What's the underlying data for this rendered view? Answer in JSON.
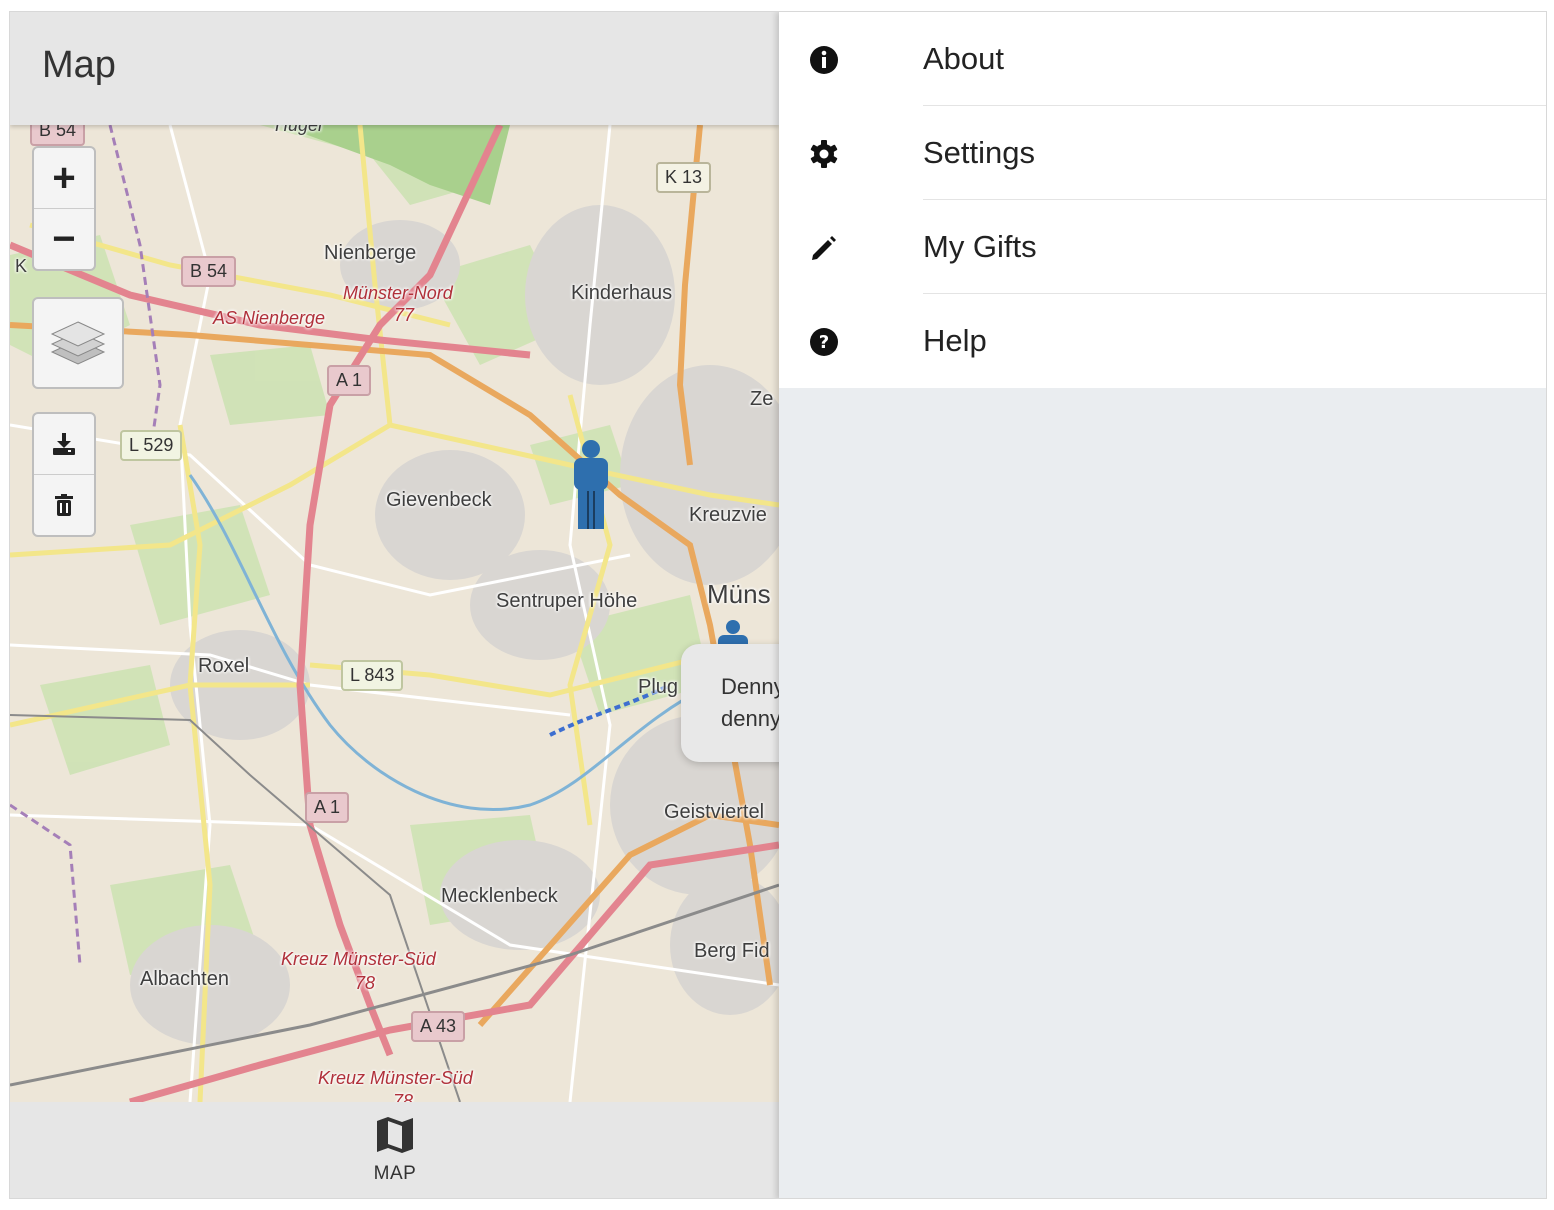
{
  "header": {
    "title": "Map"
  },
  "map": {
    "place_labels": [
      "Nienberge",
      "Kinderhaus",
      "Gievenbeck",
      "Kreuzvie",
      "Sentruper Höhe",
      "Müns",
      "Roxel",
      "Plug",
      "Geistviertel",
      "Mecklenbeck",
      "Berg Fid",
      "Albachten",
      "Ze",
      "Hügel",
      "K"
    ],
    "motorway_labels": [
      "Münster-Nord",
      "77",
      "AS Nienberge",
      "Kreuz Münster-Süd",
      "78",
      "Kreuz Münster-Süd",
      "78"
    ],
    "road_shields": [
      "B 54",
      "K 13",
      "B 54",
      "A 1",
      "L 529",
      "L 843",
      "A 1",
      "A 43"
    ],
    "controls": {
      "zoom_in": "+",
      "zoom_out": "−"
    }
  },
  "popup": {
    "line1": "Denny",
    "line2": "denny"
  },
  "tabbar": {
    "tabs": [
      {
        "label": "MAP",
        "icon": "map-icon"
      }
    ]
  },
  "side_menu": {
    "items": [
      {
        "label": "About",
        "icon": "info-icon"
      },
      {
        "label": "Settings",
        "icon": "gear-icon"
      },
      {
        "label": "My Gifts",
        "icon": "pencil-icon"
      },
      {
        "label": "Help",
        "icon": "help-icon"
      }
    ]
  },
  "colors": {
    "header_bg": "#e6e6e6",
    "menu_bg": "#ffffff",
    "backdrop": "#eaedf0",
    "marker": "#2e6fae",
    "motorway": "#e3848f"
  }
}
